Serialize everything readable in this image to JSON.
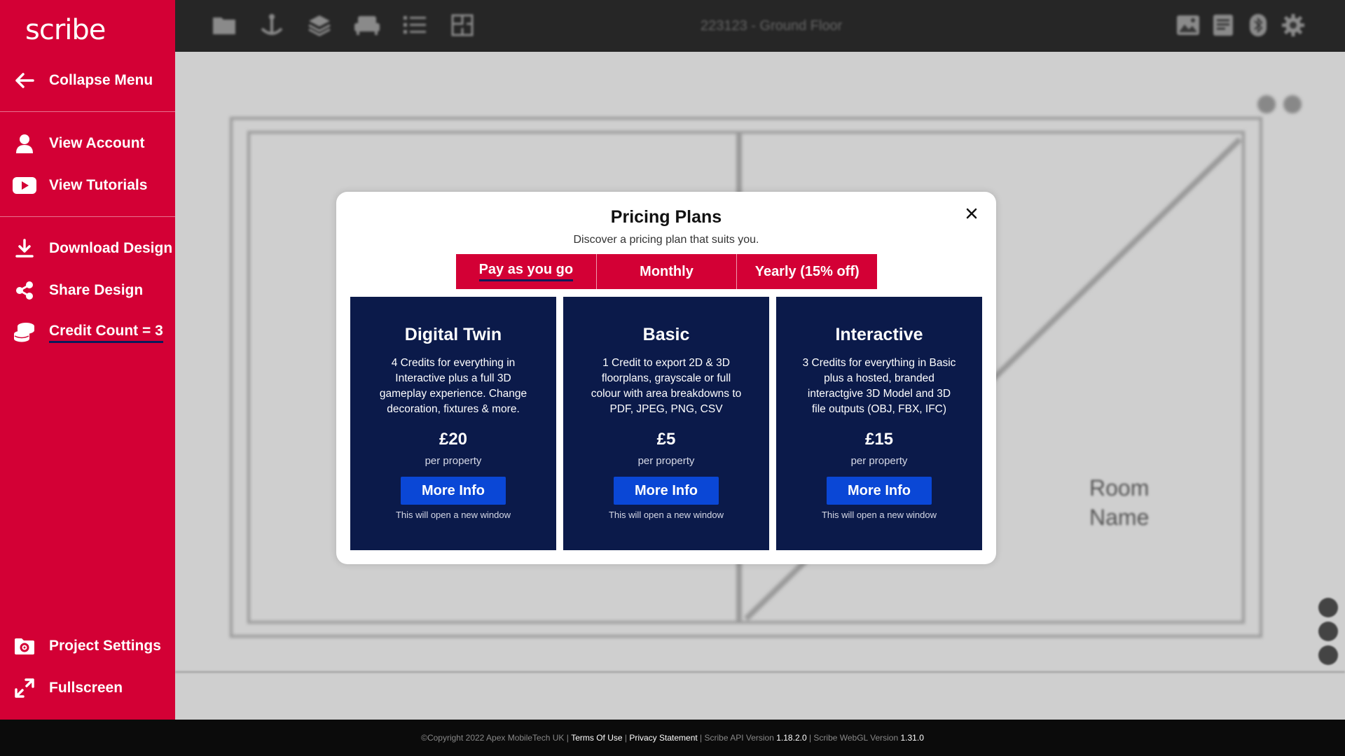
{
  "app": {
    "logo": "scribe",
    "brand_color": "#d30035",
    "panel_color": "#0b1a4a",
    "button_color": "#0a47d6"
  },
  "sidebar": {
    "collapse": {
      "label": "Collapse Menu",
      "icon": "arrow-left-icon"
    },
    "items_top": [
      {
        "label": "View Account",
        "icon": "user-icon"
      },
      {
        "label": "View Tutorials",
        "icon": "youtube-icon"
      }
    ],
    "items_mid": [
      {
        "label": "Download Design",
        "icon": "download-icon"
      },
      {
        "label": "Share Design",
        "icon": "share-icon"
      },
      {
        "label": "Credit Count = 3",
        "icon": "coins-icon"
      }
    ],
    "items_bottom": [
      {
        "label": "Project Settings",
        "icon": "folder-settings-icon"
      },
      {
        "label": "Fullscreen",
        "icon": "expand-icon"
      }
    ]
  },
  "topbar": {
    "title": "223123 - Ground Floor"
  },
  "canvas": {
    "room_label_line1": "Room",
    "room_label_line2": "Name"
  },
  "modal": {
    "title": "Pricing Plans",
    "subtitle": "Discover a pricing plan that suits you.",
    "tabs": [
      {
        "label": "Pay as you go",
        "active": true
      },
      {
        "label": "Monthly",
        "active": false
      },
      {
        "label": "Yearly (15% off)",
        "active": false
      }
    ],
    "plans": [
      {
        "name": "Digital Twin",
        "description": "4 Credits for everything in Interactive plus a full 3D gameplay experience. Change decoration, fixtures & more.",
        "price": "£20",
        "per": "per property",
        "button": "More Info",
        "note": "This will open a new window"
      },
      {
        "name": "Basic",
        "description": "1 Credit to export 2D & 3D floorplans, grayscale or full colour with area breakdowns to PDF, JPEG, PNG, CSV",
        "price": "£5",
        "per": "per property",
        "button": "More Info",
        "note": "This will open a new window"
      },
      {
        "name": "Interactive",
        "description": "3 Credits for everything in Basic plus a hosted, branded interactgive 3D Model and 3D file outputs (OBJ, FBX, IFC)",
        "price": "£15",
        "per": "per property",
        "button": "More Info",
        "note": "This will open a new window"
      }
    ]
  },
  "footer": {
    "copyright": "©Copyright 2022 Apex MobileTech UK",
    "terms": "Terms Of Use",
    "privacy": "Privacy Statement",
    "api_label": "Scribe API Version",
    "api_version": "1.18.2.0",
    "webgl_label": "Scribe WebGL Version",
    "webgl_version": "1.31.0"
  }
}
